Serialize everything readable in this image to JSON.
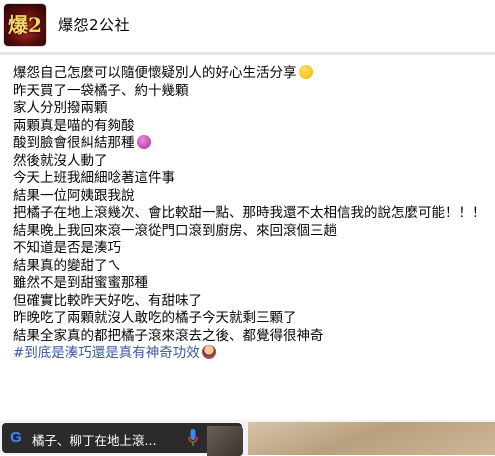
{
  "header": {
    "page_name": "爆怨2公社",
    "avatar_text": "爆2"
  },
  "post": {
    "lines": [
      "爆怨自己怎麼可以隨便懷疑別人的好心生活分享",
      "昨天買了一袋橘子、約十幾顆",
      "家人分別撥兩顆",
      "兩顆真是喵的有夠酸",
      "酸到臉會很糾結那種",
      "然後就沒人動了",
      "今天上班我細細唸著這件事",
      "結果一位阿姨跟我說",
      "把橘子在地上滾幾次、會比較甜一點、那時我還不太相信我的說怎麼可能！！！",
      "結果晚上我回來滾一滾從門口滾到廚房、來回滾個三趟",
      "不知道是否是湊巧",
      "結果真的變甜了ㄟ",
      "雖然不是到甜蜜蜜那種",
      "但確實比較昨天好吃、有甜味了",
      "昨晚吃了兩顆就沒人敢吃的橘子今天就剩三顆了",
      "結果全家真的都把橘子滾來滾去之後、都覺得很神奇"
    ],
    "hashtag": "#到底是湊巧還是真有神奇功效"
  },
  "search_bar": {
    "query": "橘子、柳丁在地上滾..."
  },
  "colors": {
    "hashtag": "#385898",
    "text": "#050505"
  }
}
